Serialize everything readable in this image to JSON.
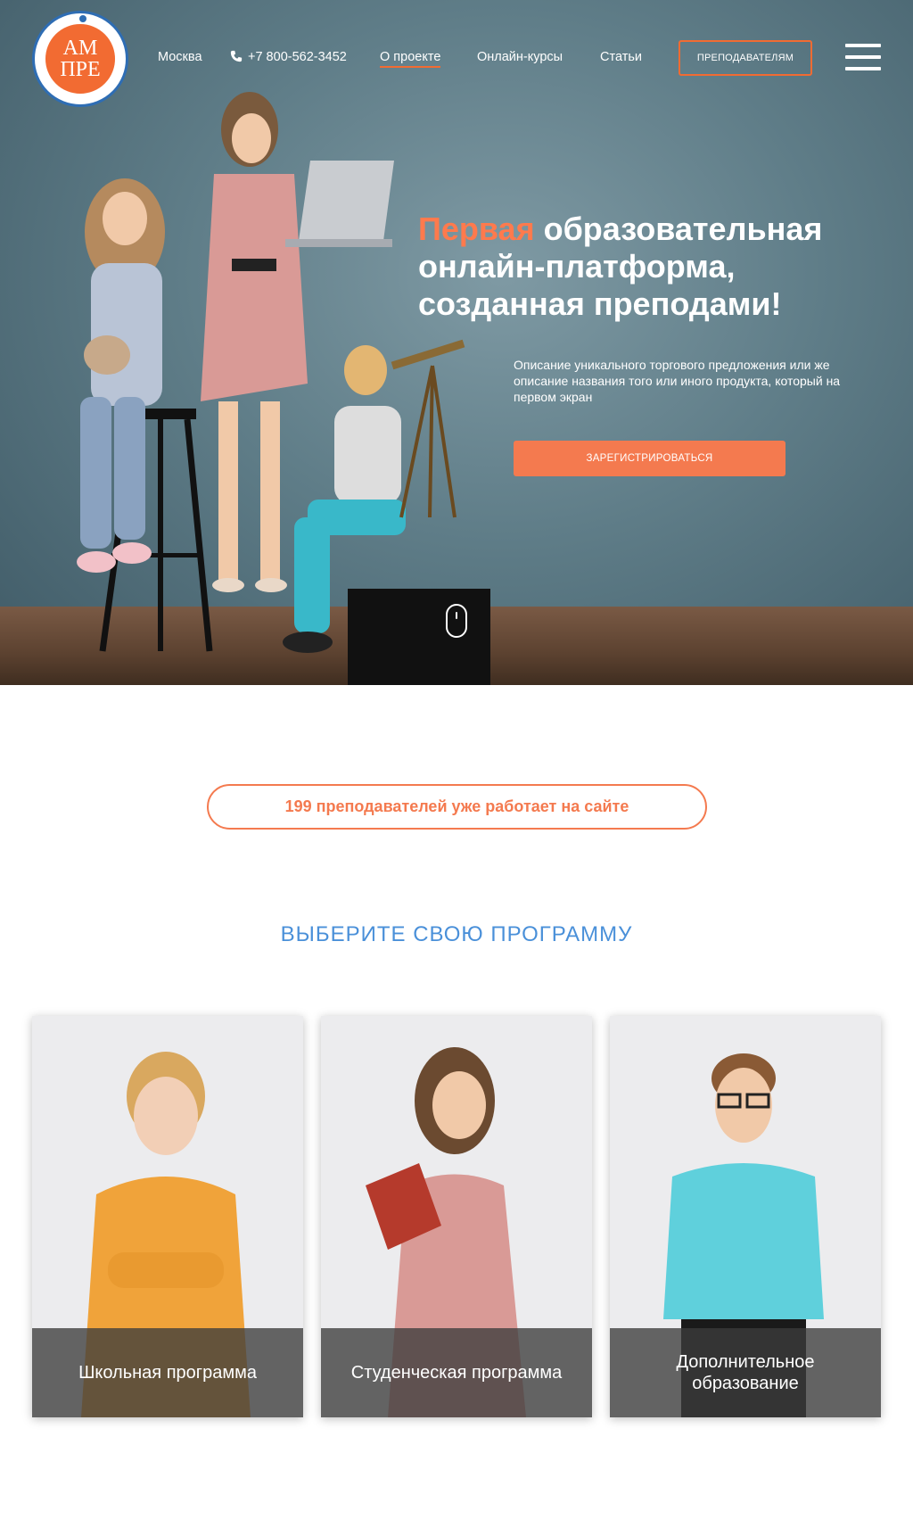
{
  "header": {
    "logo_text_top": "АМ",
    "logo_text_bottom": "ПРЕ",
    "city": "Москва",
    "phone": "+7 800-562-3452",
    "nav": [
      {
        "label": "О проекте",
        "active": true
      },
      {
        "label": "Онлайн-курсы",
        "active": false
      },
      {
        "label": "Статьи",
        "active": false
      }
    ],
    "teachers_button": "ПРЕПОДАВАТЕЛЯМ",
    "menu_icon": "hamburger-icon"
  },
  "hero": {
    "title_accent": "Первая",
    "title_rest": " образовательная онлайн-платформа, созданная преподами!",
    "description": "Описание уникального торгового предложения или же описание названия того или иного продукта, который на первом экран",
    "register_button": "ЗАРЕГИСТРИРОВАТЬСЯ",
    "scroll_icon": "mouse-scroll-icon"
  },
  "counter": {
    "text": "199 преподавателей уже работает на сайте"
  },
  "programs": {
    "title": "ВЫБЕРИТЕ СВОЮ ПРОГРАММУ",
    "cards": [
      {
        "label": "Школьная программа"
      },
      {
        "label": "Студенческая программа"
      },
      {
        "label": "Дополнительное образование"
      }
    ]
  },
  "colors": {
    "accent": "#f47a4f",
    "brand_blue": "#4a90d9",
    "logo_blue": "#2e6db4",
    "white": "#ffffff"
  }
}
